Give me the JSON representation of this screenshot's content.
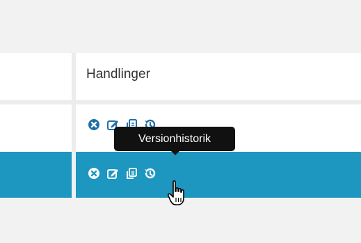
{
  "table": {
    "header": {
      "actions_column": "Handlinger"
    }
  },
  "tooltip": {
    "text": "Versionhistorik"
  },
  "colors": {
    "icon_normal": "#1f6fa8",
    "icon_selected": "#ffffff",
    "selected_row": "#1d97bf",
    "tooltip_bg": "#111111"
  },
  "icons": [
    "delete-icon",
    "edit-icon",
    "copy-icon",
    "history-icon",
    "hand-cursor-icon"
  ]
}
